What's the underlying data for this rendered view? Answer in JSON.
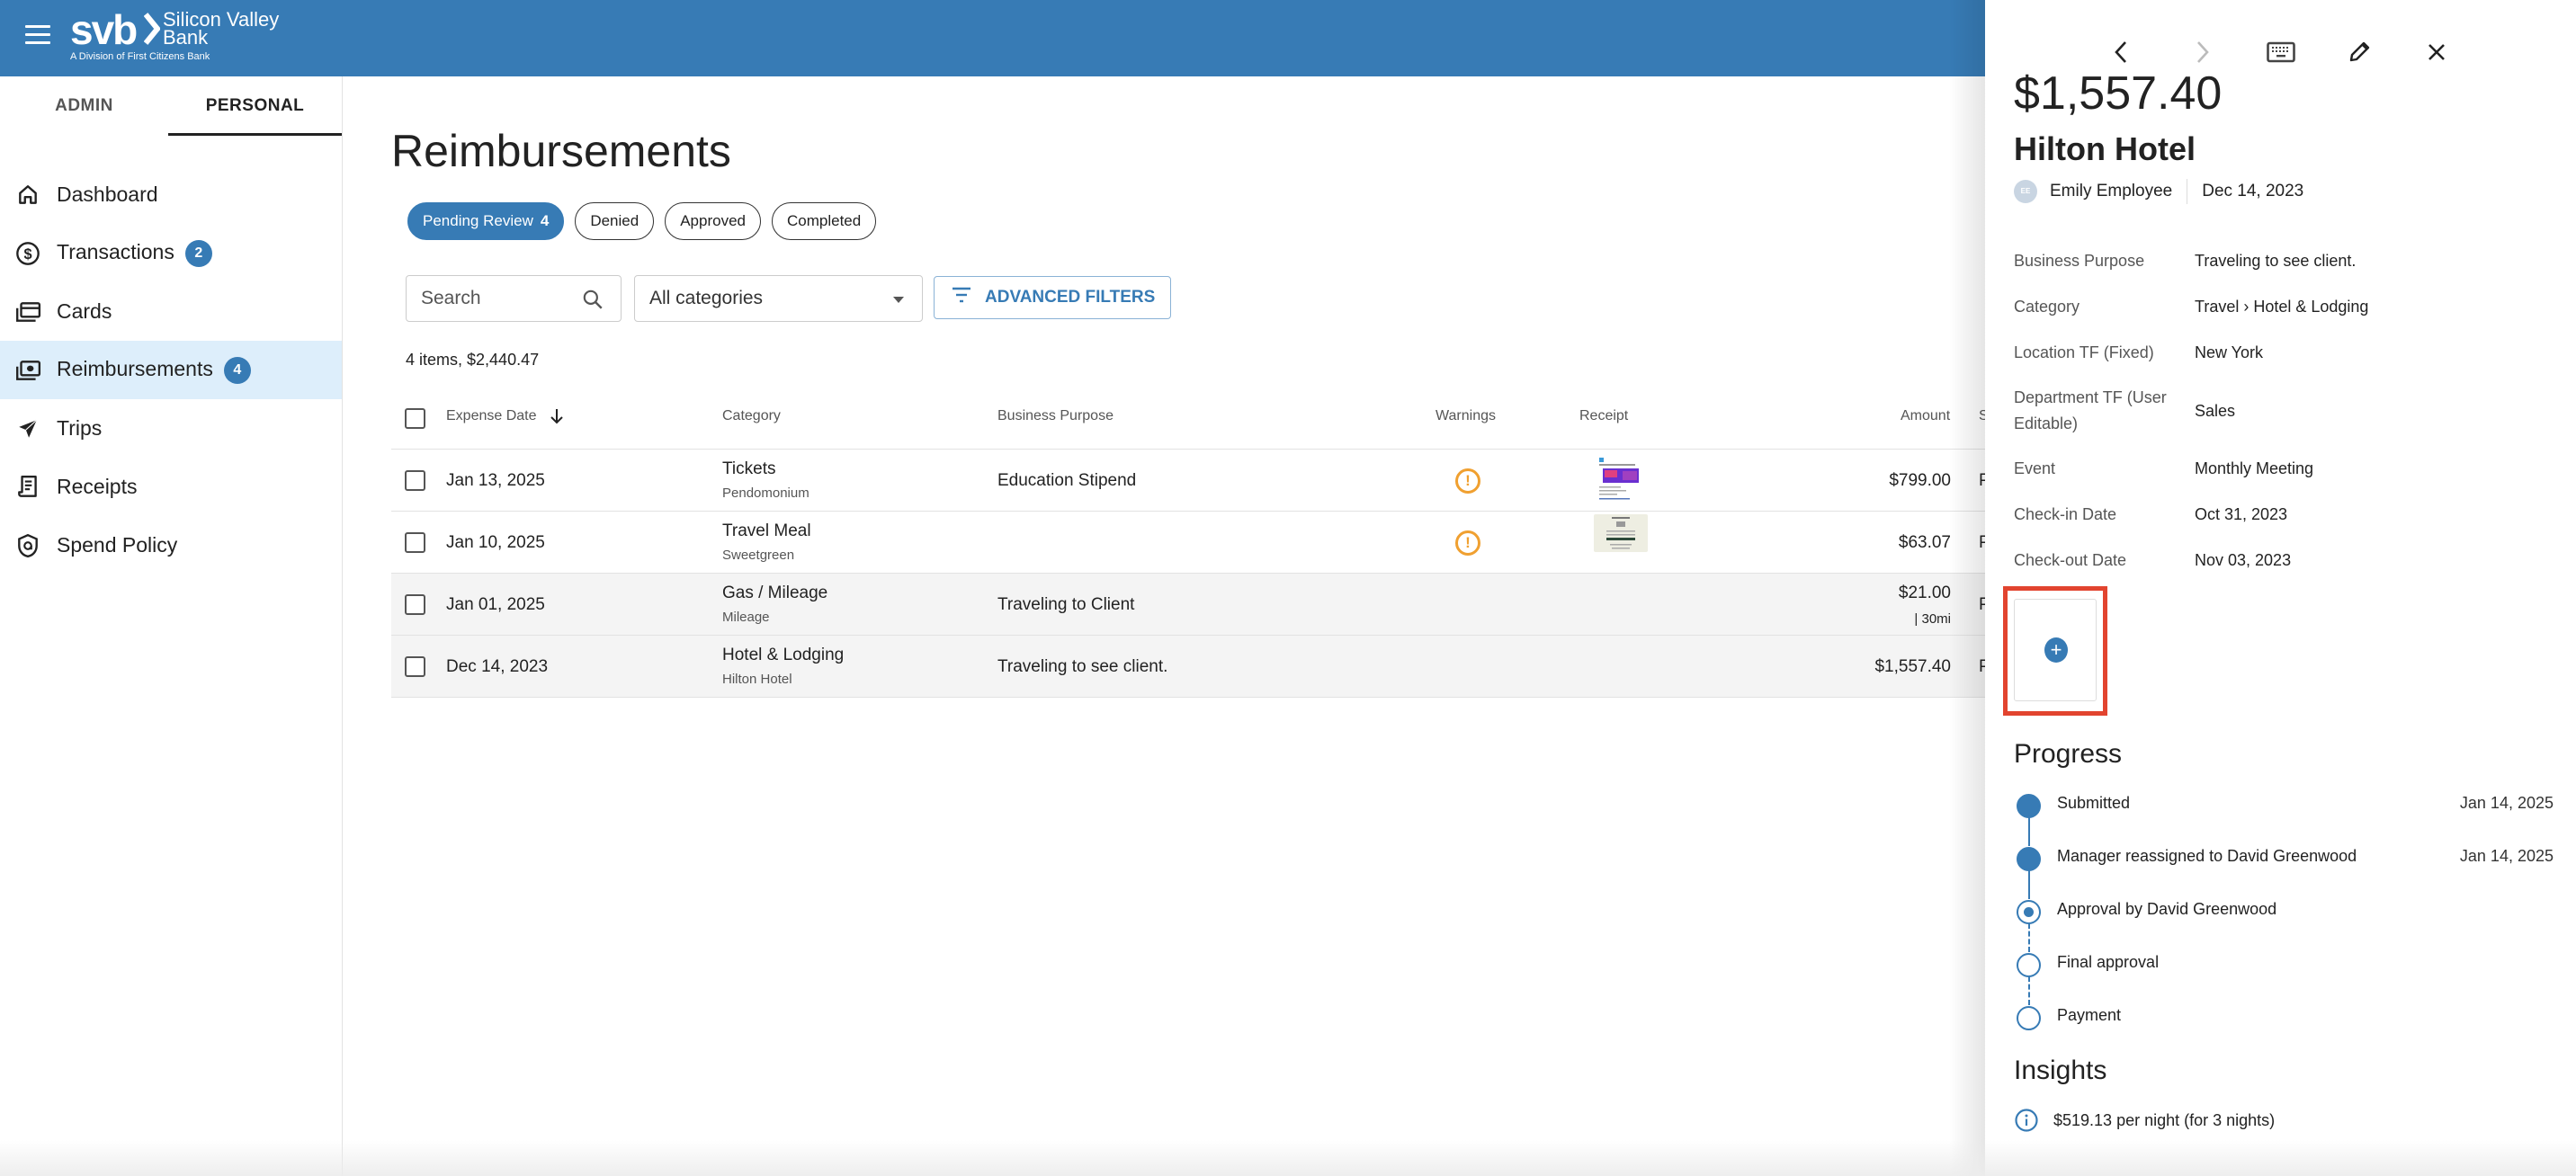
{
  "header": {
    "brand_short": "svb",
    "brand_chevron": "›",
    "brand_name_line1": "Silicon Valley",
    "brand_name_line2": "Bank",
    "brand_division": "A Division of First Citizens Bank",
    "menu_icon": "hamburger-icon",
    "header_color": "#377bb5"
  },
  "sidebar": {
    "tabs": [
      {
        "label": "ADMIN",
        "active": false
      },
      {
        "label": "PERSONAL",
        "active": true
      }
    ],
    "items": [
      {
        "label": "Dashboard",
        "icon": "home-icon",
        "badge": null,
        "active": false
      },
      {
        "label": "Transactions",
        "icon": "dollar-circle-icon",
        "badge": "2",
        "active": false
      },
      {
        "label": "Cards",
        "icon": "cards-icon",
        "badge": null,
        "active": false
      },
      {
        "label": "Reimbursements",
        "icon": "cash-icon",
        "badge": "4",
        "active": true
      },
      {
        "label": "Trips",
        "icon": "airplane-icon",
        "badge": null,
        "active": false
      },
      {
        "label": "Receipts",
        "icon": "receipt-icon",
        "badge": null,
        "active": false
      },
      {
        "label": "Spend Policy",
        "icon": "policy-shield-icon",
        "badge": null,
        "active": false
      }
    ]
  },
  "main": {
    "title": "Reimbursements",
    "status_filters": [
      {
        "label": "Pending Review",
        "count": "4",
        "active": true
      },
      {
        "label": "Denied",
        "count": null,
        "active": false
      },
      {
        "label": "Approved",
        "count": null,
        "active": false
      },
      {
        "label": "Completed",
        "count": null,
        "active": false
      }
    ],
    "search": {
      "placeholder": "Search",
      "value": ""
    },
    "category_select": {
      "value": "All categories"
    },
    "advanced_filters_label": "ADVANCED FILTERS",
    "summary": "4 items, $2,440.47",
    "table": {
      "columns": [
        "Expense Date",
        "Category",
        "Business Purpose",
        "Warnings",
        "Receipt",
        "Amount",
        "S"
      ],
      "sort": {
        "column": "Expense Date",
        "direction": "desc"
      },
      "rows": [
        {
          "date": "Jan 13, 2025",
          "category": "Tickets",
          "merchant": "Pendomonium",
          "purpose": "Education Stipend",
          "warning": true,
          "receipt": "event-ticket",
          "amount": "$799.00",
          "amount_sub": null,
          "status": "P"
        },
        {
          "date": "Jan 10, 2025",
          "category": "Travel Meal",
          "merchant": "Sweetgreen",
          "purpose": "",
          "warning": true,
          "receipt": "restaurant-receipt",
          "amount": "$63.07",
          "amount_sub": null,
          "status": "P"
        },
        {
          "date": "Jan 01, 2025",
          "category": "Gas / Mileage",
          "merchant": "Mileage",
          "purpose": "Traveling to Client",
          "warning": false,
          "receipt": null,
          "amount": "$21.00",
          "amount_sub": "|   30mi",
          "status": "P"
        },
        {
          "date": "Dec 14, 2023",
          "category": "Hotel & Lodging",
          "merchant": "Hilton Hotel",
          "purpose": "Traveling to see client.",
          "warning": false,
          "receipt": null,
          "amount": "$1,557.40",
          "amount_sub": null,
          "status": "P"
        }
      ]
    }
  },
  "drawer": {
    "toolbar": [
      "chevron-left-icon",
      "chevron-right-icon",
      "keyboard-icon",
      "pencil-icon",
      "close-icon"
    ],
    "amount": "$1,557.40",
    "merchant": "Hilton Hotel",
    "employee_initials": "EE",
    "employee": "Emily Employee",
    "date": "Dec 14, 2023",
    "fields": [
      {
        "label": "Business Purpose",
        "value": "Traveling to see client."
      },
      {
        "label": "Category",
        "value": "Travel › Hotel & Lodging"
      },
      {
        "label": "Location TF (Fixed)",
        "value": "New York"
      },
      {
        "label": "Department TF (User Editable)",
        "value": "Sales"
      },
      {
        "label": "Event",
        "value": "Monthly Meeting"
      },
      {
        "label": "Check-in Date",
        "value": "Oct 31, 2023"
      },
      {
        "label": "Check-out Date",
        "value": "Nov 03, 2023"
      }
    ],
    "add_receipt_icon": "plus-circle-icon",
    "progress_title": "Progress",
    "progress": [
      {
        "label": "Submitted",
        "date": "Jan 14, 2025",
        "state": "done"
      },
      {
        "label": "Manager reassigned to David Greenwood",
        "date": "Jan 14, 2025",
        "state": "done"
      },
      {
        "label": "Approval by David Greenwood",
        "date": "",
        "state": "current"
      },
      {
        "label": "Final approval",
        "date": "",
        "state": "pending"
      },
      {
        "label": "Payment",
        "date": "",
        "state": "pending"
      }
    ],
    "insights_title": "Insights",
    "insights": [
      {
        "icon": "info-icon",
        "text": "$519.13 per night (for 3 nights)"
      }
    ],
    "highlight_color": "#e2442f",
    "accent_color": "#377bb5",
    "warning_color": "#f0a030"
  }
}
